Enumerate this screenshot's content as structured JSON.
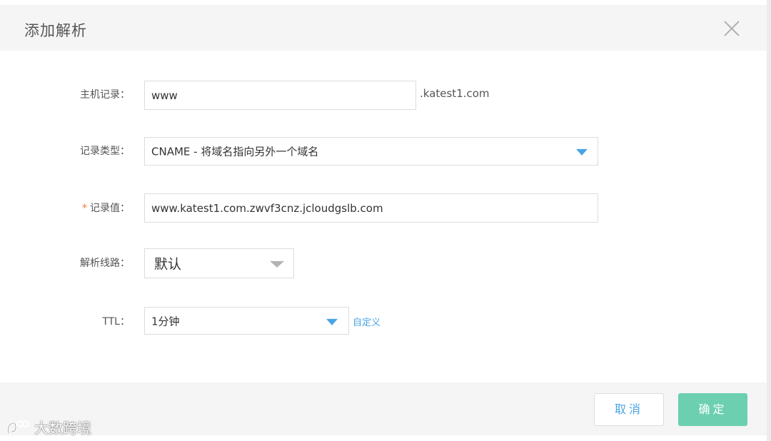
{
  "dialog": {
    "title": "添加解析",
    "close_icon": "close-icon"
  },
  "form": {
    "host_record": {
      "label": "主机记录：",
      "value": "www",
      "suffix": ".katest1.com"
    },
    "record_type": {
      "label": "记录类型：",
      "selected": "CNAME - 将域名指向另外一个域名",
      "icon": "caret-down-icon"
    },
    "record_value": {
      "required_mark": "*",
      "label": "记录值：",
      "value": "www.katest1.com.zwvf3cnz.jcloudgslb.com"
    },
    "line": {
      "label": "解析线路：",
      "selected": "默认",
      "icon": "caret-down-icon"
    },
    "ttl": {
      "label": "TTL：",
      "selected": "1分钟",
      "icon": "caret-down-icon",
      "custom_link": "自定义"
    }
  },
  "footer": {
    "cancel_label": "取消",
    "confirm_label": "确定"
  },
  "watermark": {
    "text": "大数跨境",
    "icon": "logo-icon"
  },
  "colors": {
    "accent": "#4aa4e6",
    "confirm": "#6ccfb0",
    "required": "#f0703c",
    "header_bg": "#f5f5f5"
  }
}
